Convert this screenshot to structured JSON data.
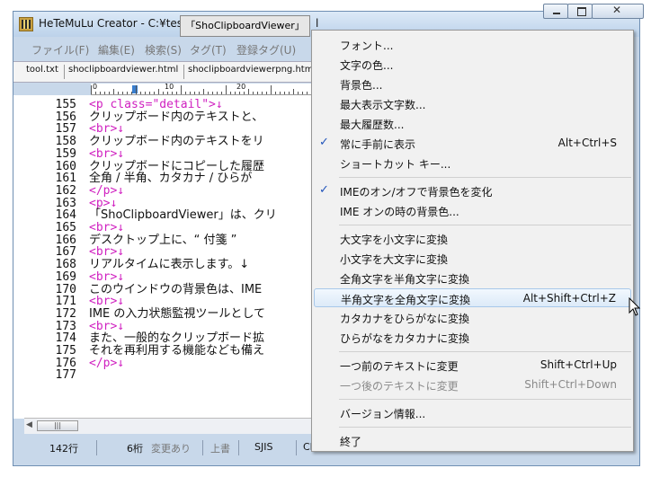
{
  "window": {
    "title": "HeTeMuLu Creator - C:¥tes",
    "title_tail": "l",
    "tooltip": "「ShoClipboardViewer」"
  },
  "menubar": [
    "ファイル(F)",
    "編集(E)",
    "検索(S)",
    "タグ(T)",
    "登録タグ(U)"
  ],
  "tabs": [
    "tool.txt",
    "shoclipboardviewer.html",
    "shoclipboardviewerpng.htm"
  ],
  "ruler": [
    "0",
    "10",
    "20"
  ],
  "editor": {
    "lines": [
      {
        "n": "155",
        "text": "<p class=\"detail\">↓",
        "tag": true
      },
      {
        "n": "156",
        "text": "クリップボード内のテキストと、",
        "tag": false
      },
      {
        "n": "157",
        "text": "<br>↓",
        "tag": true
      },
      {
        "n": "158",
        "text": "クリップボード内のテキストをリ",
        "tag": false
      },
      {
        "n": "159",
        "text": "<br>↓",
        "tag": true
      },
      {
        "n": "160",
        "text": "クリップボードにコピーした履歴",
        "tag": false
      },
      {
        "n": "161",
        "text": "全角 / 半角、カタカナ / ひらが",
        "tag": false
      },
      {
        "n": "162",
        "text": "</p>↓",
        "tag": true
      },
      {
        "n": "163",
        "text": "<p>↓",
        "tag": true
      },
      {
        "n": "164",
        "text": "「ShoClipboardViewer」は、クリ",
        "tag": false
      },
      {
        "n": "165",
        "text": "<br>↓",
        "tag": true
      },
      {
        "n": "166",
        "text": "デスクトップ上に、“ 付箋 ” ",
        "tag": false
      },
      {
        "n": "167",
        "text": "<br>↓",
        "tag": true
      },
      {
        "n": "168",
        "text": "リアルタイムに表示します。↓",
        "tag": false
      },
      {
        "n": "169",
        "text": "<br>↓",
        "tag": true
      },
      {
        "n": "170",
        "text": "このウインドウの背景色は、IME ",
        "tag": false
      },
      {
        "n": "171",
        "text": "<br>↓",
        "tag": true
      },
      {
        "n": "172",
        "text": "IME の入力状態監視ツールとして",
        "tag": false
      },
      {
        "n": "173",
        "text": "<br>↓",
        "tag": true
      },
      {
        "n": "174",
        "text": "また、一般的なクリップボード拡",
        "tag": false
      },
      {
        "n": "175",
        "text": "それを再利用する機能なども備え",
        "tag": false
      },
      {
        "n": "176",
        "text": "</p>↓",
        "tag": true
      },
      {
        "n": "177",
        "text": "",
        "tag": false
      }
    ]
  },
  "statusbar": {
    "line": "142行",
    "col": "6桁",
    "modified": "変更あり",
    "overwrite": "上書",
    "encoding": "SJIS",
    "eol": "CRLF"
  },
  "context_menu": {
    "groups": [
      [
        {
          "label": "フォント...",
          "shortcut": "",
          "checked": false,
          "disabled": false
        },
        {
          "label": "文字の色...",
          "shortcut": "",
          "checked": false,
          "disabled": false
        },
        {
          "label": "背景色...",
          "shortcut": "",
          "checked": false,
          "disabled": false
        },
        {
          "label": "最大表示文字数...",
          "shortcut": "",
          "checked": false,
          "disabled": false
        },
        {
          "label": "最大履歴数...",
          "shortcut": "",
          "checked": false,
          "disabled": false
        },
        {
          "label": "常に手前に表示",
          "shortcut": "Alt+Ctrl+S",
          "checked": true,
          "disabled": false
        },
        {
          "label": "ショートカット キー...",
          "shortcut": "",
          "checked": false,
          "disabled": false
        }
      ],
      [
        {
          "label": "IMEのオン/オフで背景色を変化",
          "shortcut": "",
          "checked": true,
          "disabled": false
        },
        {
          "label": "IME オンの時の背景色...",
          "shortcut": "",
          "checked": false,
          "disabled": false
        }
      ],
      [
        {
          "label": "大文字を小文字に変換",
          "shortcut": "",
          "checked": false,
          "disabled": false
        },
        {
          "label": "小文字を大文字に変換",
          "shortcut": "",
          "checked": false,
          "disabled": false
        },
        {
          "label": "全角文字を半角文字に変換",
          "shortcut": "",
          "checked": false,
          "disabled": false
        },
        {
          "label": "半角文字を全角文字に変換",
          "shortcut": "Alt+Shift+Ctrl+Z",
          "checked": false,
          "disabled": false,
          "highlighted": true
        },
        {
          "label": "カタカナをひらがなに変換",
          "shortcut": "",
          "checked": false,
          "disabled": false
        },
        {
          "label": "ひらがなをカタカナに変換",
          "shortcut": "",
          "checked": false,
          "disabled": false
        }
      ],
      [
        {
          "label": "一つ前のテキストに変更",
          "shortcut": "Shift+Ctrl+Up",
          "checked": false,
          "disabled": false
        },
        {
          "label": "一つ後のテキストに変更",
          "shortcut": "Shift+Ctrl+Down",
          "checked": false,
          "disabled": true
        }
      ],
      [
        {
          "label": "バージョン情報...",
          "shortcut": "",
          "checked": false,
          "disabled": false
        }
      ],
      [
        {
          "label": "終了",
          "shortcut": "",
          "checked": false,
          "disabled": false
        }
      ]
    ]
  },
  "icons": {
    "app": "app-grid-icon",
    "check": "check-icon",
    "pointer": "mouse-pointer-icon"
  }
}
